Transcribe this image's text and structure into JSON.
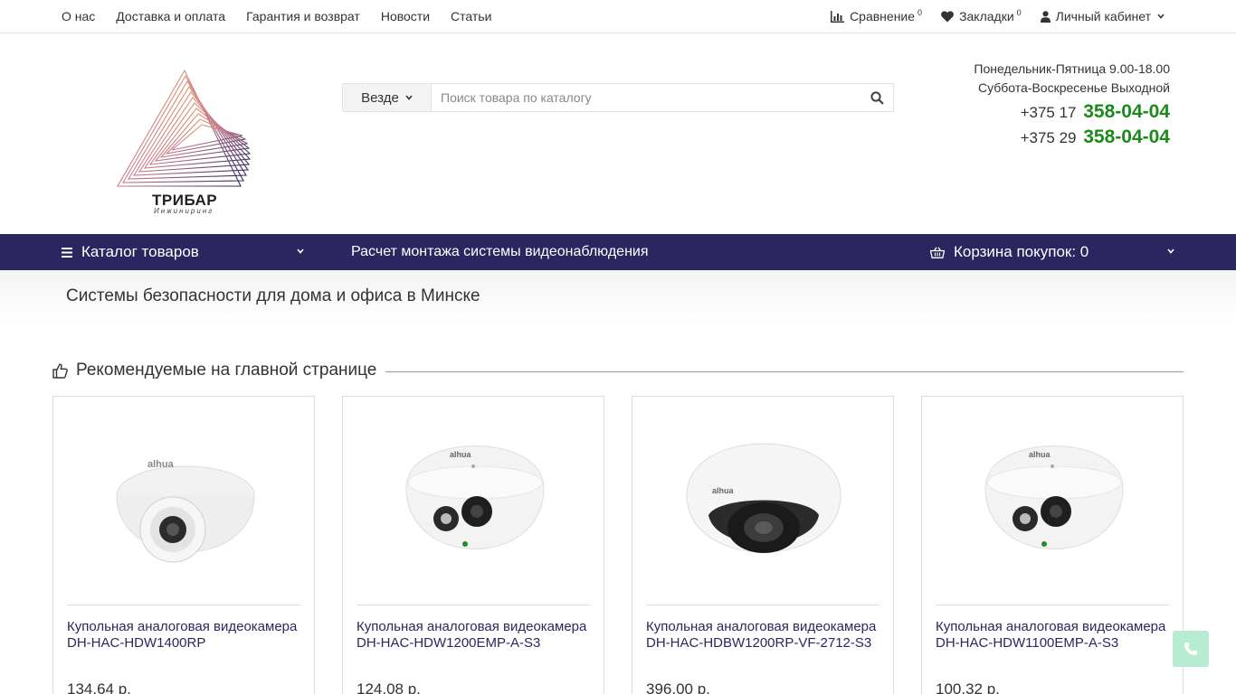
{
  "topnav": {
    "items": [
      "О нас",
      "Доставка и оплата",
      "Гарантия и возврат",
      "Новости",
      "Статьи"
    ]
  },
  "topright": {
    "compare_label": "Сравнение",
    "compare_count": "0",
    "bookmarks_label": "Закладки",
    "bookmarks_count": "0",
    "account_label": "Личный кабинет"
  },
  "logo": {
    "name": "ТРИБАР",
    "sub": "Инжиниринг",
    "colors": {
      "gradient_start": "#f2a45d",
      "gradient_end": "#2c2660"
    }
  },
  "search": {
    "scope": "Везде",
    "placeholder": "Поиск товара по каталогу",
    "value": ""
  },
  "contacts": {
    "hours_weekdays": "Понедельник-Пятница 9.00-18.00",
    "hours_weekend": "Суббота-Воскресенье Выходной",
    "phone1_prefix": "+375 17",
    "phone1_number": "358-04-04",
    "phone2_prefix": "+375 29",
    "phone2_number": "358-04-04"
  },
  "navbar": {
    "catalog_label": "Каталог товаров",
    "montage_label": "Расчет монтажа системы видеонаблюдения",
    "cart_label": "Корзина покупок: 0"
  },
  "page": {
    "title": "Системы безопасности для дома и офиса в Минске"
  },
  "section": {
    "title": "Рекомендуемые на главной странице"
  },
  "products": [
    {
      "name": "Купольная аналоговая видеокамера DH-HAC-HDW1400RP",
      "price": "134,64 р."
    },
    {
      "name": "Купольная аналоговая видеокамера DH-HAC-HDW1200EMP-A-S3",
      "price": "124,08 р."
    },
    {
      "name": "Купольная аналоговая видеокамера DH-HAC-HDBW1200RP-VF-2712-S3",
      "price": "396,00 р."
    },
    {
      "name": "Купольная аналоговая видеокамера DH-HAC-HDW1100EMP-A-S3",
      "price": "100,32 р."
    }
  ],
  "colors": {
    "navbar_bg": "#2c2660",
    "phone_green": "#1b8a1b",
    "product_name": "#2c2660",
    "call_button": "#b7ecd3"
  },
  "icons": [
    "bar-chart-icon",
    "heart-icon",
    "user-icon",
    "chevron-down-icon",
    "search-icon",
    "menu-icon",
    "basket-icon",
    "thumbs-up-icon",
    "phone-icon"
  ]
}
